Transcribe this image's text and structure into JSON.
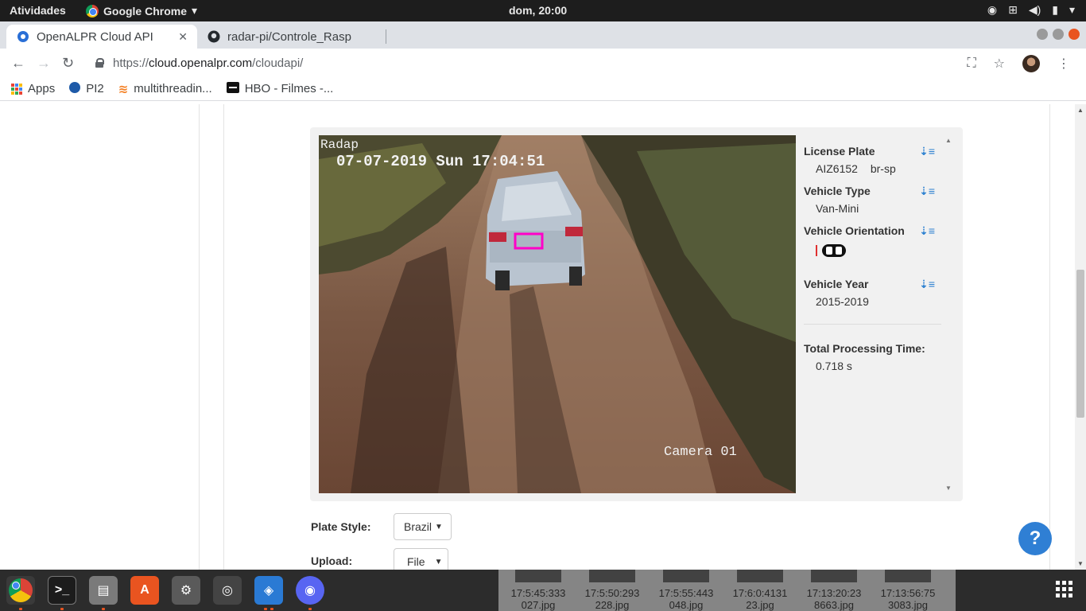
{
  "topbar": {
    "activities": "Atividades",
    "app_name": "Google Chrome",
    "clock": "dom, 20:00"
  },
  "tabs": [
    {
      "title": "OpenALPR Cloud API",
      "icon": "openalpr-icon",
      "active": true
    },
    {
      "title": "radar-pi/Controle_Rasp",
      "icon": "github-icon",
      "active": false
    }
  ],
  "address": {
    "scheme": "https://",
    "host": "cloud.openalpr.com",
    "path": "/cloudapi/"
  },
  "bookmarks": [
    {
      "label": "Apps",
      "icon": "apps-grid-icon"
    },
    {
      "label": "PI2",
      "icon": "drs-icon"
    },
    {
      "label": "multithreadin...",
      "icon": "stackoverflow-icon"
    },
    {
      "label": "HBO - Filmes -...",
      "icon": "hbo-icon"
    }
  ],
  "photo": {
    "overlay_top": "Radap",
    "timestamp": "07-07-2019 Sun 17:04:51",
    "camera": "Camera 01"
  },
  "results": {
    "license_plate": {
      "label": "License Plate",
      "value": "AIZ6152",
      "region": "br-sp"
    },
    "vehicle_type": {
      "label": "Vehicle Type",
      "value": "Van-Mini"
    },
    "vehicle_orientation": {
      "label": "Vehicle Orientation"
    },
    "vehicle_year": {
      "label": "Vehicle Year",
      "value": "2015-2019"
    },
    "processing": {
      "label": "Total Processing Time:",
      "value": "0.718 s"
    }
  },
  "form": {
    "plate_style_label": "Plate Style:",
    "plate_style_value": "Brazil",
    "upload_label": "Upload:",
    "upload_value": "File"
  },
  "help": {
    "label": "?"
  },
  "taskbar_thumbs": [
    {
      "line1": "17:5:45:333",
      "line2": "027.jpg"
    },
    {
      "line1": "17:5:50:293",
      "line2": "228.jpg"
    },
    {
      "line1": "17:5:55:443",
      "line2": "048.jpg"
    },
    {
      "line1": "17:6:0:4131",
      "line2": "23.jpg"
    },
    {
      "line1": "17:13:20:23",
      "line2": "8663.jpg"
    },
    {
      "line1": "17:13:56:75",
      "line2": "3083.jpg"
    }
  ],
  "colors": {
    "accent": "#2f7fd4",
    "plate_box": "#ff00c8",
    "ubuntu_orange": "#e95420"
  }
}
